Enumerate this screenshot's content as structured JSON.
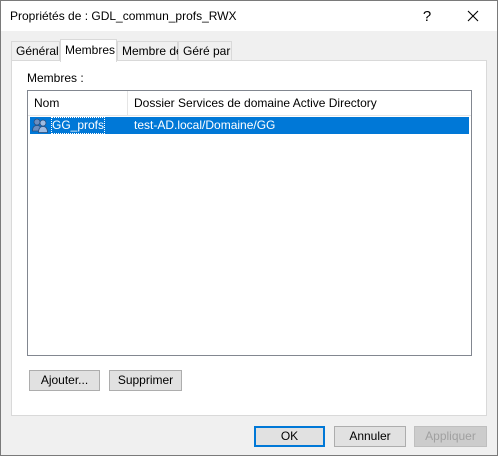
{
  "window": {
    "title": "Propriétés de : GDL_commun_profs_RWX",
    "help_label": "?",
    "close_icon": "close-icon"
  },
  "tabs": [
    {
      "label": "Général",
      "active": false
    },
    {
      "label": "Membres",
      "active": true
    },
    {
      "label": "Membre de",
      "active": false
    },
    {
      "label": "Géré par",
      "active": false
    }
  ],
  "members": {
    "label": "Membres :",
    "columns": [
      "Nom",
      "Dossier Services de domaine Active Directory"
    ],
    "rows": [
      {
        "name": "GG_profs",
        "folder": "test-AD.local/Domaine/GG",
        "icon": "group-icon",
        "selected": true
      }
    ],
    "add_label": "Ajouter...",
    "remove_label": "Supprimer"
  },
  "footer": {
    "ok_label": "OK",
    "cancel_label": "Annuler",
    "apply_label": "Appliquer"
  },
  "colors": {
    "selection": "#0078d7",
    "dialog_bg": "#f0f0f0"
  }
}
